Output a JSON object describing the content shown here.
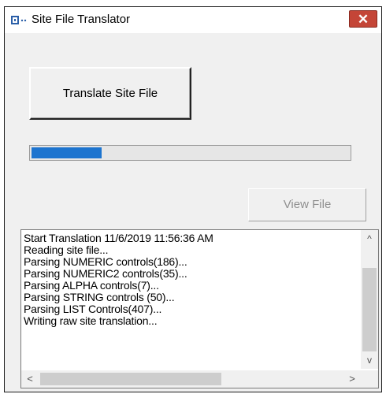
{
  "window": {
    "title": "Site File Translator",
    "close_label": "✕",
    "icon": "application-icon"
  },
  "buttons": {
    "translate_label": "Translate Site File",
    "view_label": "View File",
    "view_enabled": false
  },
  "progress": {
    "fraction": 0.22,
    "color": "#1d74cf"
  },
  "log": {
    "lines": [
      "Start Translation 11/6/2019 11:56:36 AM",
      "Reading site file...",
      "Parsing NUMERIC controls(186)...",
      "Parsing NUMERIC2 controls(35)...",
      "Parsing ALPHA controls(7)...",
      "Parsing STRING controls (50)...",
      "Parsing LIST Controls(407)...",
      "Writing raw site translation..."
    ]
  },
  "scrollbars": {
    "up": "^",
    "down": "v",
    "left": "<",
    "right": ">"
  },
  "colors": {
    "close_button": "#c44537",
    "disabled_text": "#8f8f8f"
  }
}
